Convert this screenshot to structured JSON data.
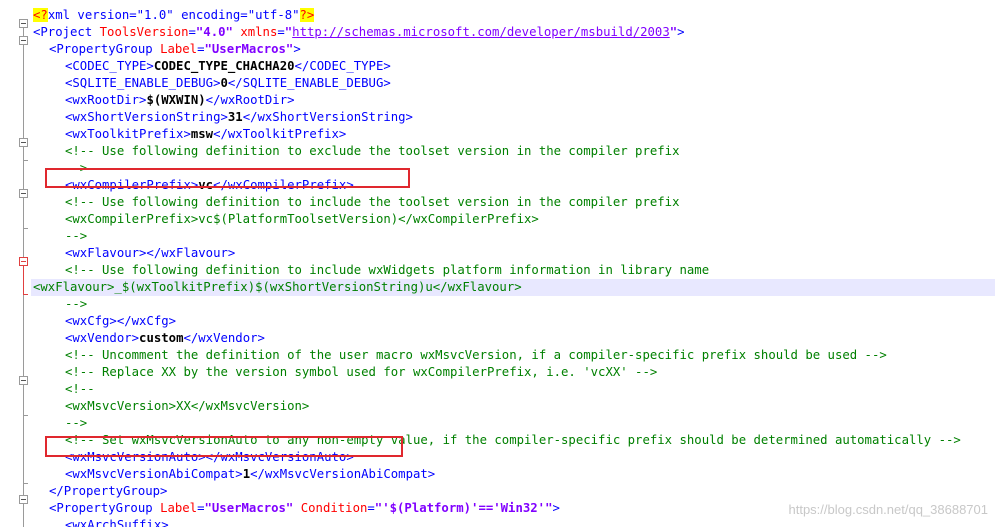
{
  "editor": {
    "lines": [
      {
        "parts": [
          {
            "k": "pi",
            "t": "<?"
          },
          {
            "k": "tag",
            "t": "xml version=\"1.0\" encoding=\"utf-8\""
          },
          {
            "k": "pi",
            "t": "?>"
          }
        ]
      },
      {
        "parts": [
          {
            "k": "tag",
            "t": "<Project "
          },
          {
            "k": "attr",
            "t": "ToolsVersion"
          },
          {
            "k": "tag",
            "t": "="
          },
          {
            "k": "val",
            "t": "\"4.0\""
          },
          {
            "k": "tag",
            "t": " "
          },
          {
            "k": "attr",
            "t": "xmlns"
          },
          {
            "k": "tag",
            "t": "="
          },
          {
            "k": "val",
            "t": "\""
          },
          {
            "k": "url",
            "t": "http://schemas.microsoft.com/developer/msbuild/2003"
          },
          {
            "k": "val",
            "t": "\""
          },
          {
            "k": "tag",
            "t": ">"
          }
        ]
      },
      {
        "ind": 1,
        "parts": [
          {
            "k": "tag",
            "t": "<PropertyGroup "
          },
          {
            "k": "attr",
            "t": "Label"
          },
          {
            "k": "tag",
            "t": "="
          },
          {
            "k": "val",
            "t": "\"UserMacros\""
          },
          {
            "k": "tag",
            "t": ">"
          }
        ]
      },
      {
        "ind": 2,
        "parts": [
          {
            "k": "tag",
            "t": "<CODEC_TYPE>"
          },
          {
            "k": "txt",
            "t": "CODEC_TYPE_CHACHA20"
          },
          {
            "k": "tag",
            "t": "</CODEC_TYPE>"
          }
        ]
      },
      {
        "ind": 2,
        "parts": [
          {
            "k": "tag",
            "t": "<SQLITE_ENABLE_DEBUG>"
          },
          {
            "k": "txt",
            "t": "0"
          },
          {
            "k": "tag",
            "t": "</SQLITE_ENABLE_DEBUG>"
          }
        ]
      },
      {
        "ind": 2,
        "parts": [
          {
            "k": "tag",
            "t": "<wxRootDir>"
          },
          {
            "k": "txt",
            "t": "$(WXWIN)"
          },
          {
            "k": "tag",
            "t": "</wxRootDir>"
          }
        ]
      },
      {
        "ind": 2,
        "parts": [
          {
            "k": "tag",
            "t": "<wxShortVersionString>"
          },
          {
            "k": "txt",
            "t": "31"
          },
          {
            "k": "tag",
            "t": "</wxShortVersionString>"
          }
        ]
      },
      {
        "ind": 2,
        "parts": [
          {
            "k": "tag",
            "t": "<wxToolkitPrefix>"
          },
          {
            "k": "txt",
            "t": "msw"
          },
          {
            "k": "tag",
            "t": "</wxToolkitPrefix>"
          }
        ]
      },
      {
        "ind": 2,
        "parts": [
          {
            "k": "cmt",
            "t": "<!-- Use following definition to exclude the toolset version in the compiler prefix"
          }
        ]
      },
      {
        "ind": 2,
        "parts": [
          {
            "k": "cmt",
            "t": "-->"
          }
        ]
      },
      {
        "ind": 2,
        "parts": [
          {
            "k": "tag",
            "t": "<wxCompilerPrefix>"
          },
          {
            "k": "txt",
            "t": "vc"
          },
          {
            "k": "tag",
            "t": "</wxCompilerPrefix>"
          }
        ]
      },
      {
        "ind": 2,
        "parts": [
          {
            "k": "cmt",
            "t": "<!-- Use following definition to include the toolset version in the compiler prefix"
          }
        ]
      },
      {
        "ind": 2,
        "parts": [
          {
            "k": "cmt",
            "t": "<wxCompilerPrefix>vc$(PlatformToolsetVersion)</wxCompilerPrefix>"
          }
        ]
      },
      {
        "ind": 2,
        "parts": [
          {
            "k": "cmt",
            "t": "-->"
          }
        ]
      },
      {
        "ind": 2,
        "parts": [
          {
            "k": "tag",
            "t": "<wxFlavour></wxFlavour>"
          }
        ]
      },
      {
        "ind": 2,
        "parts": [
          {
            "k": "cmt",
            "t": "<!-- Use following definition to include wxWidgets platform information in library name"
          }
        ]
      },
      {
        "ind": 2,
        "current": true,
        "parts": [
          {
            "k": "cmt",
            "t": "<wxFlavour>_$(wxToolkitPrefix)$(wxShortVersionString)u</wxFlavour>"
          }
        ]
      },
      {
        "ind": 2,
        "parts": [
          {
            "k": "cmt",
            "t": "-->"
          }
        ]
      },
      {
        "ind": 2,
        "parts": [
          {
            "k": "tag",
            "t": "<wxCfg></wxCfg>"
          }
        ]
      },
      {
        "ind": 2,
        "parts": [
          {
            "k": "tag",
            "t": "<wxVendor>"
          },
          {
            "k": "txt",
            "t": "custom"
          },
          {
            "k": "tag",
            "t": "</wxVendor>"
          }
        ]
      },
      {
        "ind": 2,
        "parts": [
          {
            "k": "cmt",
            "t": "<!-- Uncomment the definition of the user macro wxMsvcVersion, if a compiler-specific prefix should be used -->"
          }
        ]
      },
      {
        "ind": 2,
        "parts": [
          {
            "k": "cmt",
            "t": "<!-- Replace XX by the version symbol used for wxCompilerPrefix, i.e. 'vcXX' -->"
          }
        ]
      },
      {
        "ind": 2,
        "parts": [
          {
            "k": "cmt",
            "t": "<!--"
          }
        ]
      },
      {
        "ind": 2,
        "parts": [
          {
            "k": "cmt",
            "t": "<wxMsvcVersion>XX</wxMsvcVersion>"
          }
        ]
      },
      {
        "ind": 2,
        "parts": [
          {
            "k": "cmt",
            "t": "-->"
          }
        ]
      },
      {
        "ind": 2,
        "parts": [
          {
            "k": "cmt",
            "t": "<!-- Set wxMsvcVersionAuto to any non-empty value, if the compiler-specific prefix should be determined automatically -->"
          }
        ]
      },
      {
        "ind": 2,
        "parts": [
          {
            "k": "tag",
            "t": "<wxMsvcVersionAuto></wxMsvcVersionAuto>"
          }
        ]
      },
      {
        "ind": 2,
        "parts": [
          {
            "k": "tag",
            "t": "<wxMsvcVersionAbiCompat>"
          },
          {
            "k": "txt",
            "t": "1"
          },
          {
            "k": "tag",
            "t": "</wxMsvcVersionAbiCompat>"
          }
        ]
      },
      {
        "ind": 1,
        "parts": [
          {
            "k": "tag",
            "t": "</PropertyGroup>"
          }
        ]
      },
      {
        "ind": 1,
        "parts": [
          {
            "k": "tag",
            "t": "<PropertyGroup "
          },
          {
            "k": "attr",
            "t": "Label"
          },
          {
            "k": "tag",
            "t": "="
          },
          {
            "k": "val",
            "t": "\"UserMacros\""
          },
          {
            "k": "tag",
            "t": " "
          },
          {
            "k": "attr",
            "t": "Condition"
          },
          {
            "k": "tag",
            "t": "="
          },
          {
            "k": "val",
            "t": "\"'$(Platform)'=='Win32'\""
          },
          {
            "k": "tag",
            "t": ">"
          }
        ]
      },
      {
        "ind": 2,
        "parts": [
          {
            "k": "tag",
            "t": "<wxArchSuffix>"
          }
        ]
      }
    ]
  },
  "watermark": "https://blog.csdn.net/qq_38688701",
  "colors": {
    "tag": "#0000ff",
    "attribute": "#ff0000",
    "attribute_value": "#8000ff",
    "comment": "#008000",
    "highlight_box": "#e0282e",
    "current_line": "#e8e8ff"
  }
}
